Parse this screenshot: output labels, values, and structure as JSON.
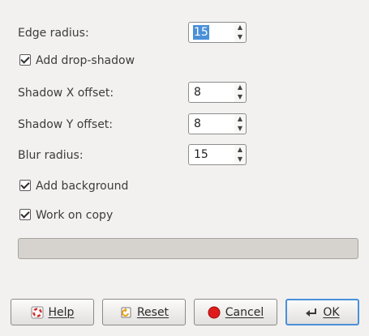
{
  "form": {
    "edge_radius": {
      "label": "Edge radius:",
      "value": "15"
    },
    "add_drop_shadow": {
      "label": "Add drop-shadow",
      "checked": true
    },
    "shadow_x": {
      "label": "Shadow X offset:",
      "value": "8"
    },
    "shadow_y": {
      "label": "Shadow Y offset:",
      "value": "8"
    },
    "blur_radius": {
      "label": "Blur radius:",
      "value": "15"
    },
    "add_background": {
      "label": "Add background",
      "checked": true
    },
    "work_on_copy": {
      "label": "Work on copy",
      "checked": true
    }
  },
  "progress": {
    "value": 0
  },
  "buttons": {
    "help": "Help",
    "reset": "Reset",
    "cancel": "Cancel",
    "ok": "OK"
  },
  "icons": {
    "help": "help-icon",
    "reset": "reset-icon",
    "cancel": "cancel-icon",
    "ok": "ok-icon",
    "spin_up": "chevron-up-icon",
    "spin_down": "chevron-down-icon",
    "checkbox": "checkmark-icon"
  },
  "colors": {
    "background": "#f2f1f0",
    "focus_selection": "#4a90d9",
    "cancel_red": "#e01b1b"
  }
}
